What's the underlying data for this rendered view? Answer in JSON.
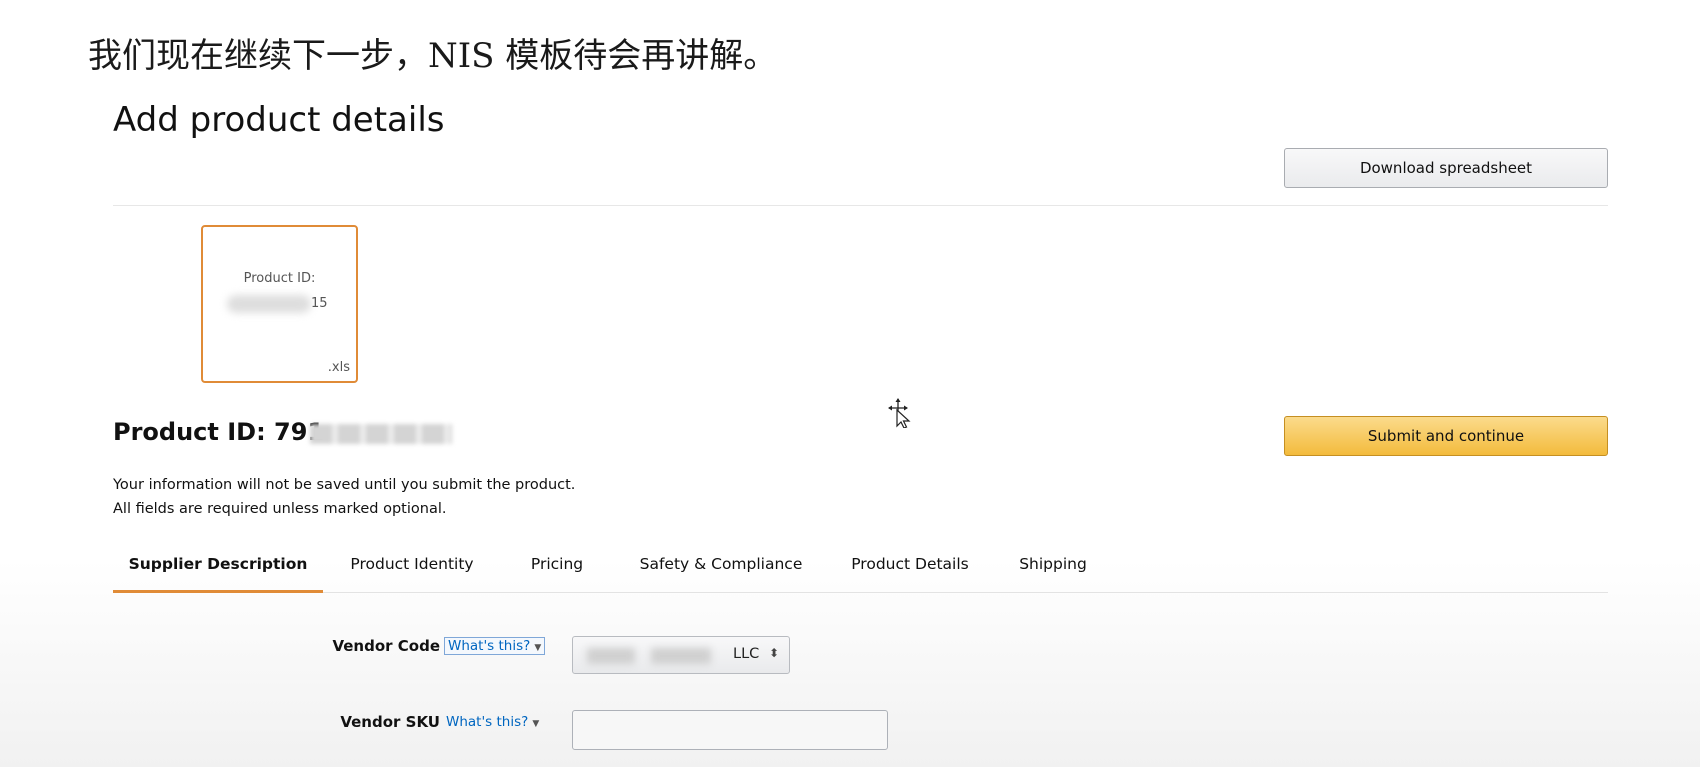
{
  "caption": "我们现在继续下一步，NIS 模板待会再讲解。",
  "page": {
    "title": "Add product details"
  },
  "toolbar": {
    "download_label": "Download spreadsheet",
    "submit_label": "Submit and continue"
  },
  "file_card": {
    "label": "Product ID:",
    "id_suffix": "15",
    "extension": ".xls"
  },
  "product": {
    "id_label": "Product ID: 791"
  },
  "notes": [
    "Your information will not be saved until you submit the product.",
    "All fields are required unless marked optional."
  ],
  "tabs": [
    {
      "label": "Supplier Description",
      "active": true
    },
    {
      "label": "Product Identity",
      "active": false
    },
    {
      "label": "Pricing",
      "active": false
    },
    {
      "label": "Safety & Compliance",
      "active": false
    },
    {
      "label": "Product Details",
      "active": false
    },
    {
      "label": "Shipping",
      "active": false
    }
  ],
  "form": {
    "vendor_code": {
      "label": "Vendor Code",
      "help": "What's this?",
      "selected_value": "LLC"
    },
    "vendor_sku": {
      "label": "Vendor SKU",
      "help": "What's this?",
      "value": "",
      "placeholder": ""
    }
  },
  "colors": {
    "accent_orange": "#e08b37",
    "submit_yellow": "#f3bb3c",
    "link_blue": "#0066c0"
  }
}
